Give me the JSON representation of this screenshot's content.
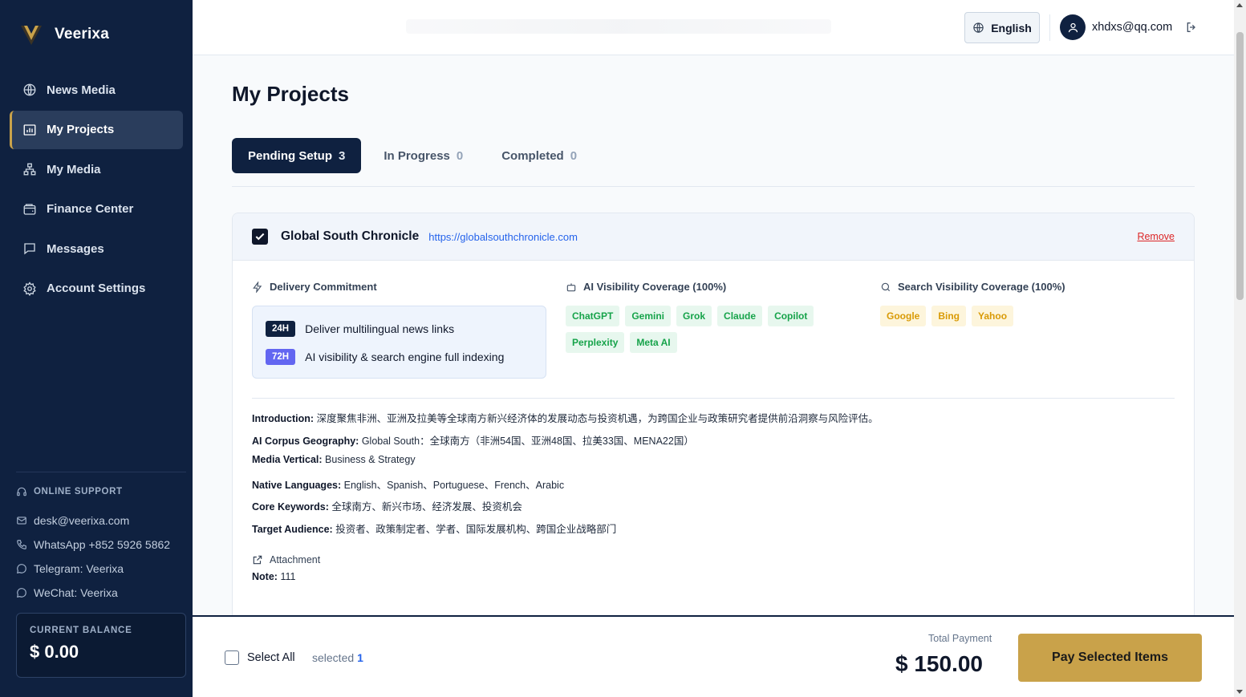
{
  "app": {
    "name": "Veerixa"
  },
  "sidebar": {
    "items": [
      {
        "label": "News Media",
        "icon": "globe-icon",
        "active": false
      },
      {
        "label": "My Projects",
        "icon": "chart-icon",
        "active": true
      },
      {
        "label": "My Media",
        "icon": "network-icon",
        "active": false
      },
      {
        "label": "Finance Center",
        "icon": "wallet-icon",
        "active": false
      },
      {
        "label": "Messages",
        "icon": "message-icon",
        "active": false
      },
      {
        "label": "Account Settings",
        "icon": "gear-icon",
        "active": false
      }
    ],
    "support": {
      "title": "ONLINE SUPPORT",
      "email": "desk@veerixa.com",
      "whatsapp": "WhatsApp +852 5926 5862",
      "telegram": "Telegram: Veerixa",
      "wechat": "WeChat: Veerixa"
    },
    "balance": {
      "label": "CURRENT BALANCE",
      "value": "$ 0.00"
    }
  },
  "header": {
    "language": "English",
    "user_email": "xhdxs@qq.com"
  },
  "main": {
    "title": "My Projects",
    "tabs": [
      {
        "label": "Pending Setup",
        "count": "3",
        "active": true
      },
      {
        "label": "In Progress",
        "count": "0",
        "active": false
      },
      {
        "label": "Completed",
        "count": "0",
        "active": false
      }
    ],
    "project": {
      "checked": true,
      "name": "Global South Chronicle",
      "url": "https://globalsouthchronicle.com",
      "remove_label": "Remove",
      "delivery": {
        "title": "Delivery Commitment",
        "rows": [
          {
            "badge": "24H",
            "text": "Deliver multilingual news links"
          },
          {
            "badge": "72H",
            "text": "AI visibility & search engine full indexing"
          }
        ]
      },
      "ai_visibility": {
        "title": "AI Visibility Coverage (100%)",
        "chips": [
          "ChatGPT",
          "Gemini",
          "Grok",
          "Claude",
          "Copilot",
          "Perplexity",
          "Meta AI"
        ]
      },
      "search_visibility": {
        "title": "Search Visibility Coverage (100%)",
        "chips": [
          "Google",
          "Bing",
          "Yahoo"
        ]
      },
      "details": [
        {
          "label": "Introduction:",
          "value": "深度聚焦非洲、亚洲及拉美等全球南方新兴经济体的发展动态与投资机遇，为跨国企业与政策研究者提供前沿洞察与风险评估。"
        },
        {
          "label": "AI Corpus Geography:",
          "value": "Global South：全球南方（非洲54国、亚洲48国、拉美33国、MENA22国）"
        },
        {
          "label": "Media Vertical:",
          "value": "Business & Strategy"
        },
        {
          "label": "Native Languages:",
          "value": "English、Spanish、Portuguese、French、Arabic"
        },
        {
          "label": "Core Keywords:",
          "value": "全球南方、新兴市场、经济发展、投资机会"
        },
        {
          "label": "Target Audience:",
          "value": "投资者、政策制定者、学者、国际发展机构、跨国企业战略部门"
        }
      ],
      "attachment_label": "Attachment",
      "note": {
        "label": "Note:",
        "value": "111"
      }
    }
  },
  "footer": {
    "select_all_label": "Select All",
    "selected_label": "selected",
    "selected_count": "1",
    "total_label": "Total Payment",
    "total_value": "$ 150.00",
    "pay_label": "Pay Selected Items"
  },
  "colors": {
    "sidebar_bg": "#0f2140",
    "accent_gold": "#c9a24a",
    "link_blue": "#2563eb",
    "remove_red": "#dc2626"
  }
}
